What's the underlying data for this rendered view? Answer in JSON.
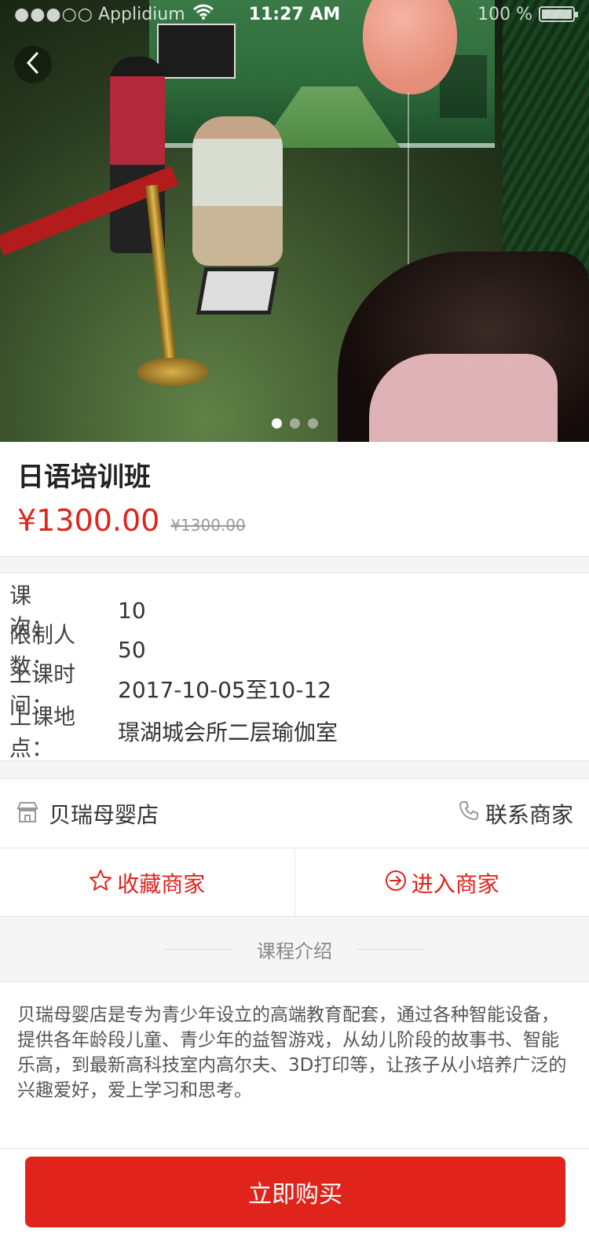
{
  "status_bar": {
    "signal": "●●●○○",
    "carrier": "Applidium",
    "time": "11:27 AM",
    "battery": "100 %"
  },
  "gallery": {
    "image_count": 3,
    "active_index": 0
  },
  "product": {
    "title": "日语培训班",
    "price": "¥1300.00",
    "original_price": "¥1300.00"
  },
  "course_info": [
    {
      "label": "课　　次：",
      "value": "10"
    },
    {
      "label": "限制人数：",
      "value": "50"
    },
    {
      "label": "上课时间：",
      "value": "2017-10-05至10-12"
    },
    {
      "label": "上课地点：",
      "value": "璟湖城会所二层瑜伽室"
    }
  ],
  "store": {
    "name": "贝瑞母婴店",
    "contact_label": "联系商家",
    "favorite_label": "收藏商家",
    "enter_label": "进入商家"
  },
  "section": {
    "heading": "课程介绍"
  },
  "description": "贝瑞母婴店是专为青少年设立的高端教育配套，通过各种智能设备，提供各年龄段儿童、青少年的益智游戏，从幼儿阶段的故事书、智能乐高，到最新高科技室内高尔夫、3D打印等，让孩子从小培养广泛的兴趣爱好，爱上学习和思考。",
  "buy_label": "立即购买",
  "colors": {
    "accent": "#e0241c",
    "background": "#f5f5f5"
  },
  "icons": [
    "back-icon",
    "store-icon",
    "phone-icon",
    "star-icon",
    "enter-icon"
  ]
}
